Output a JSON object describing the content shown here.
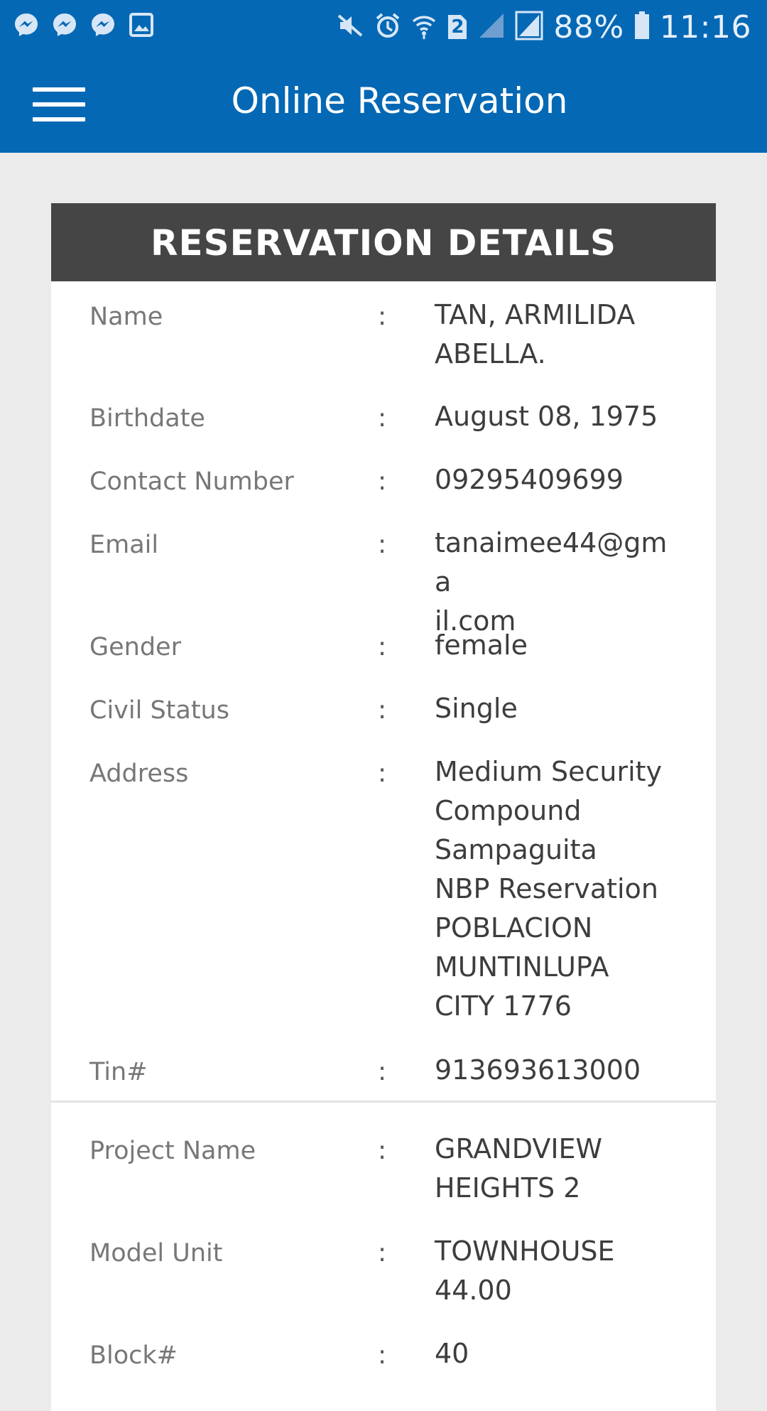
{
  "status_bar": {
    "battery": "88%",
    "time": "11:16",
    "sim_badge": "2",
    "left_icons": [
      "messenger-icon",
      "messenger-icon",
      "messenger-icon",
      "gallery-icon"
    ],
    "right_icons": [
      "mute-icon",
      "alarm-icon",
      "wifi-icon",
      "sim-2-icon",
      "signal-icon",
      "signal-icon",
      "battery-icon"
    ]
  },
  "app_bar": {
    "title": "Online Reservation",
    "menu_icon": "hamburger-menu-icon"
  },
  "card": {
    "title": "RESERVATION DETAILS",
    "personal": [
      {
        "label": "Name",
        "colon": ":",
        "value": "TAN, ARMILIDA\nABELLA."
      },
      {
        "label": "Birthdate",
        "colon": ":",
        "value": "August 08, 1975"
      },
      {
        "label": "Contact Number",
        "colon": ":",
        "value": "09295409699"
      },
      {
        "label": "Email",
        "colon": ":",
        "value": "tanaimee44@gma\nil.com"
      },
      {
        "label": "Gender",
        "colon": ":",
        "value": "female"
      },
      {
        "label": "Civil Status",
        "colon": ":",
        "value": "Single"
      },
      {
        "label": "Address",
        "colon": ":",
        "value": "Medium Security\nCompound\nSampaguita\nNBP Reservation\nPOBLACION\nMUNTINLUPA\nCITY 1776"
      },
      {
        "label": "Tin#",
        "colon": ":",
        "value": "913693613000"
      }
    ],
    "property": [
      {
        "label": "Project Name",
        "colon": ":",
        "value": "GRANDVIEW\nHEIGHTS 2"
      },
      {
        "label": "Model Unit",
        "colon": ":",
        "value": "TOWNHOUSE\n44.00"
      },
      {
        "label": "Block#",
        "colon": ":",
        "value": "40"
      }
    ]
  },
  "colors": {
    "primary": "#0468b5",
    "header_bg": "#454545",
    "page_bg": "#ebebeb"
  }
}
